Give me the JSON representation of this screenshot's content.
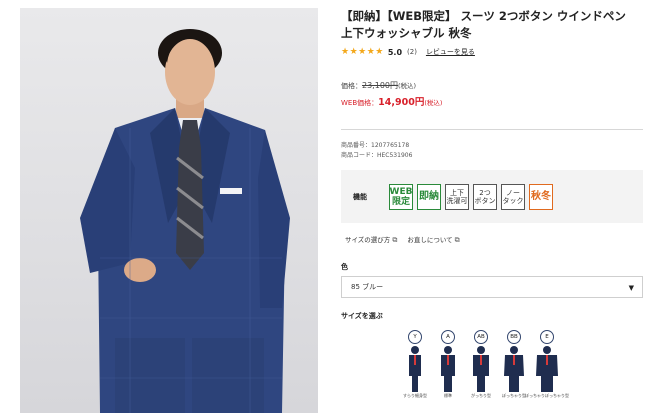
{
  "product": {
    "title_line1": "【即納】【WEB限定】 スーツ 2つボタン ウインドペン",
    "title_line2": "上下ウォッシャブル 秋冬",
    "stars": "★★★★★",
    "rating_value": "5.0",
    "review_count": "(2)",
    "review_link": "レビューを見る",
    "rating_fraction": 1.0
  },
  "price": {
    "list_label": "価格：",
    "list_value": "23,100円",
    "list_tax": "(税込)",
    "web_label": "WEB価格：",
    "web_value": "14,900円",
    "web_tax": "(税込)",
    "web_color": "#d8202a"
  },
  "codes": {
    "product_no": "商品番号：1207765178",
    "product_code": "商品コード：HEC531906"
  },
  "features": {
    "label": "機能",
    "badges": [
      {
        "l1": "WEB",
        "l2": "限定"
      },
      {
        "l1": "即納",
        "l2": ""
      },
      {
        "l1": "上下",
        "l2": "洗濯可"
      },
      {
        "l1": "2つ",
        "l2": "ボタン"
      },
      {
        "l1": "ノー",
        "l2": "タック"
      },
      {
        "l1": "秋冬",
        "l2": ""
      }
    ],
    "accent_green": "#2a8a3a",
    "accent_orange": "#e06a1f"
  },
  "links": {
    "size_guide": "サイズの選び方",
    "tailoring": "お直しについて"
  },
  "color": {
    "label": "色",
    "selected": "85 ブルー"
  },
  "sizes": {
    "label": "サイズを選ぶ",
    "items": [
      {
        "code": "Y",
        "caption": "すらり細身型"
      },
      {
        "code": "A",
        "caption": "標準"
      },
      {
        "code": "AB",
        "caption": "がっちり型"
      },
      {
        "code": "BB",
        "caption": "ぽっちゃり型"
      },
      {
        "code": "E",
        "caption": "ぽっちゃりぽっちゃり型"
      }
    ]
  }
}
